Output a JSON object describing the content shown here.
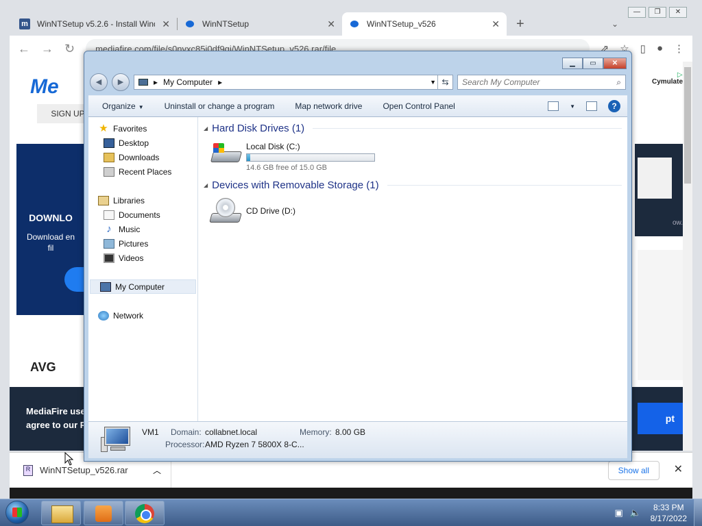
{
  "browser": {
    "tabs": [
      {
        "title": "WinNTSetup v5.2.6 - Install Windows",
        "active": false
      },
      {
        "title": "WinNTSetup",
        "active": false
      },
      {
        "title": "WinNTSetup_v526",
        "active": true
      }
    ],
    "new_tab_symbol": "+",
    "url": "mediafire.com/file/s0nvxc85i0df9gi/WinNTSetup_v526.rar/file",
    "page": {
      "logo_text": "Me",
      "signup_label": "SIGN UP",
      "ad_brand": "Cymulate",
      "download_heading": "DOWNLO",
      "download_text_1": "Download en",
      "download_text_2": "fil",
      "avg_logo": "AVG",
      "cookie_text_1": "MediaFire use",
      "cookie_text_2": "agree to our P",
      "accept_label": "pt",
      "right_ad_text": "ow."
    },
    "downloads_bar": {
      "file_name": "WinNTSetup_v526.rar",
      "show_all_label": "Show all"
    }
  },
  "explorer": {
    "breadcrumb": "My Computer",
    "search_placeholder": "Search My Computer",
    "commands": [
      "Organize",
      "Uninstall or change a program",
      "Map network drive",
      "Open Control Panel"
    ],
    "nav": {
      "favorites": "Favorites",
      "desktop": "Desktop",
      "downloads": "Downloads",
      "recent": "Recent Places",
      "libraries": "Libraries",
      "documents": "Documents",
      "music": "Music",
      "pictures": "Pictures",
      "videos": "Videos",
      "computer": "My Computer",
      "network": "Network"
    },
    "groups": {
      "hdd": "Hard Disk Drives (1)",
      "removable": "Devices with Removable Storage (1)"
    },
    "drives": {
      "c_name": "Local Disk (C:)",
      "c_free": "14.6 GB free of 15.0 GB",
      "c_used_fraction": 0.027,
      "d_name": "CD Drive (D:)"
    },
    "details": {
      "computer_name": "VM1",
      "domain_label": "Domain:",
      "domain_value": "collabnet.local",
      "memory_label": "Memory:",
      "memory_value": "8.00 GB",
      "processor_label": "Processor:",
      "processor_value": "AMD Ryzen 7 5800X 8-C..."
    }
  },
  "taskbar": {
    "time": "8:33 PM",
    "date": "8/17/2022"
  }
}
